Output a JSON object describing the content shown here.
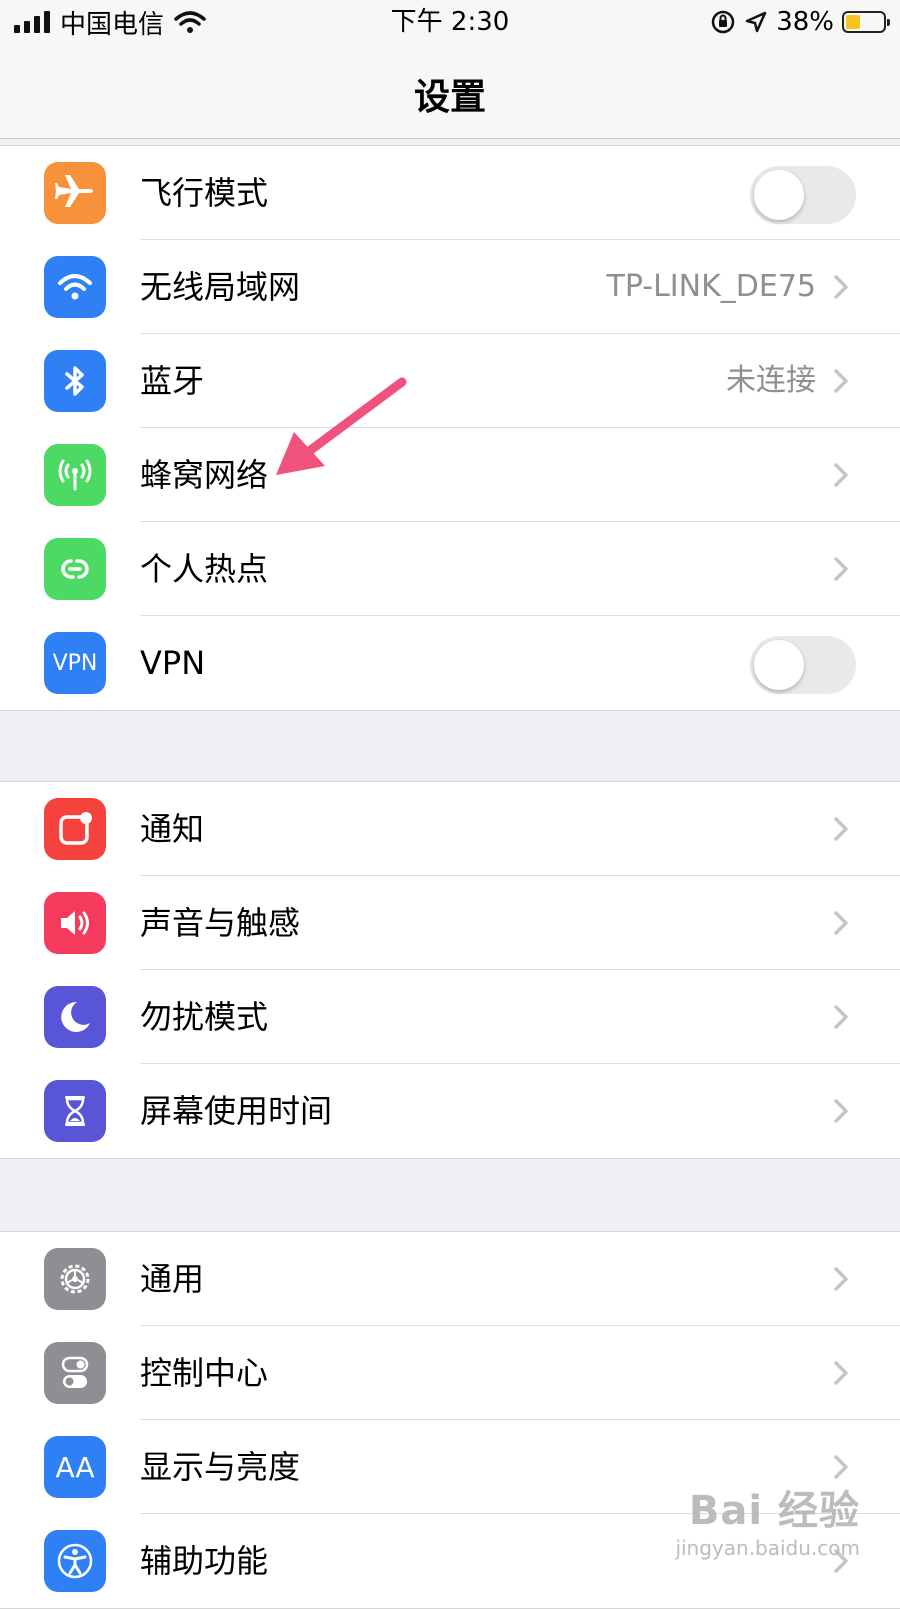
{
  "status_bar": {
    "carrier": "中国电信",
    "time": "下午 2:30",
    "battery_percent": "38%",
    "battery_level": 0.38,
    "battery_color": "#f5c423"
  },
  "nav": {
    "title": "设置"
  },
  "groups": [
    {
      "items": [
        {
          "id": "airplane",
          "label": "飞行模式",
          "icon": "airplane-icon",
          "color": "#f7923a",
          "accessory": "toggle",
          "toggle_on": false
        },
        {
          "id": "wifi",
          "label": "无线局域网",
          "icon": "wifi-icon",
          "color": "#2f7ff5",
          "accessory": "chevron",
          "detail": "TP-LINK_DE75"
        },
        {
          "id": "bluetooth",
          "label": "蓝牙",
          "icon": "bluetooth-icon",
          "color": "#2f7ff5",
          "accessory": "chevron",
          "detail": "未连接"
        },
        {
          "id": "cellular",
          "label": "蜂窝网络",
          "icon": "cellular-antenna-icon",
          "color": "#4cd964",
          "accessory": "chevron"
        },
        {
          "id": "hotspot",
          "label": "个人热点",
          "icon": "hotspot-link-icon",
          "color": "#4cd964",
          "accessory": "chevron"
        },
        {
          "id": "vpn",
          "label": "VPN",
          "icon": "vpn-icon",
          "icon_text": "VPN",
          "color": "#2f7ff5",
          "accessory": "toggle",
          "toggle_on": false
        }
      ]
    },
    {
      "items": [
        {
          "id": "notifications",
          "label": "通知",
          "icon": "notifications-icon",
          "color": "#f5423c",
          "accessory": "chevron"
        },
        {
          "id": "sounds",
          "label": "声音与触感",
          "icon": "speaker-icon",
          "color": "#f53b5b",
          "accessory": "chevron"
        },
        {
          "id": "dnd",
          "label": "勿扰模式",
          "icon": "moon-icon",
          "color": "#5856d6",
          "accessory": "chevron"
        },
        {
          "id": "screentime",
          "label": "屏幕使用时间",
          "icon": "hourglass-icon",
          "color": "#5856d6",
          "accessory": "chevron"
        }
      ]
    },
    {
      "items": [
        {
          "id": "general",
          "label": "通用",
          "icon": "gear-icon",
          "color": "#8e8e93",
          "accessory": "chevron"
        },
        {
          "id": "control-center",
          "label": "控制中心",
          "icon": "toggles-icon",
          "color": "#8e8e93",
          "accessory": "chevron"
        },
        {
          "id": "display",
          "label": "显示与亮度",
          "icon": "text-size-icon",
          "icon_text": "AA",
          "color": "#2f7ff5",
          "accessory": "chevron"
        },
        {
          "id": "accessibility",
          "label": "辅助功能",
          "icon": "accessibility-icon",
          "color": "#2f7ff5",
          "accessory": "chevron"
        }
      ]
    }
  ],
  "annotation": {
    "arrow_color": "#f0527e"
  },
  "watermark": {
    "main": "Bai 经验",
    "sub": "jingyan.baidu.com"
  }
}
